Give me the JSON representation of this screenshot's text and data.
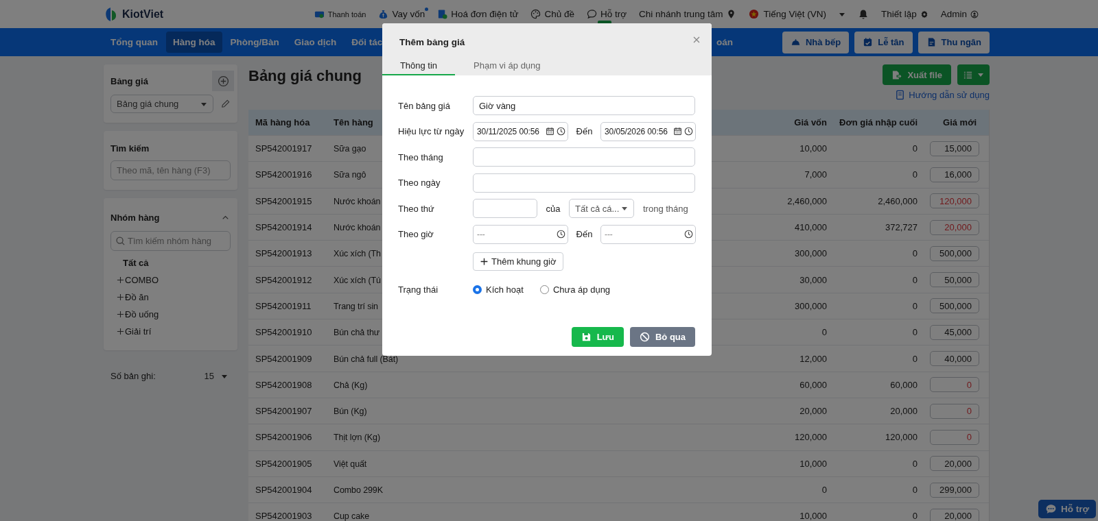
{
  "topbar": {
    "brand": "KiotViet",
    "items": [
      {
        "label": "Thanh toán",
        "dot": false,
        "marked": false
      },
      {
        "label": "Vay vốn",
        "dot": true,
        "marked": false
      },
      {
        "label": "Hoá đơn điện tử",
        "dot": false,
        "marked": false
      },
      {
        "label": "Chủ đề",
        "dot": false,
        "marked": false
      },
      {
        "label": "Hỗ trợ",
        "dot": false,
        "marked": true
      }
    ],
    "branch": "Chi nhánh trung tâm",
    "language": "Tiếng Việt (VN)",
    "settings": "Thiết lập",
    "user": "Admin"
  },
  "nav": {
    "items": [
      {
        "label": "Tổng quan",
        "selected": false
      },
      {
        "label": "Hàng hóa",
        "selected": true
      },
      {
        "label": "Phòng/Bàn",
        "selected": false
      },
      {
        "label": "Giao dịch",
        "selected": false
      },
      {
        "label": "Đối tác",
        "selected": false
      },
      {
        "label": "oán",
        "selected": false
      }
    ],
    "buttons": [
      "Nhà bếp",
      "Lễ tân",
      "Thu ngân"
    ]
  },
  "sidebar": {
    "price_list": {
      "title": "Bảng giá",
      "value": "Bảng giá chung"
    },
    "search": {
      "title": "Tìm kiếm",
      "placeholder": "Theo mã, tên hàng (F3)"
    },
    "groups": {
      "title": "Nhóm hàng",
      "expanded": true,
      "placeholder": "Tìm kiếm nhóm hàng",
      "all": {
        "label": "Tất cả",
        "selected": true
      },
      "items": [
        {
          "label": "COMBO",
          "expanded": false,
          "selected": false
        },
        {
          "label": "Đồ ăn",
          "expanded": false,
          "selected": false
        },
        {
          "label": "Đồ uống",
          "expanded": false,
          "selected": false
        },
        {
          "label": "Giải trí",
          "expanded": false,
          "selected": false
        }
      ]
    },
    "records": {
      "label": "Số bản ghi:",
      "value": "15"
    }
  },
  "main": {
    "title": "Bảng giá chung",
    "export": "Xuất file",
    "guide": "Hướng dẫn sử dụng",
    "table": {
      "columns": [
        "Mã hàng hóa",
        "Tên hàng",
        "Giá vốn",
        "Đơn giá nhập cuối",
        "Giá mới"
      ],
      "rows": [
        {
          "code": "SP542001917",
          "name": "Sữa gạo",
          "cost": "10,000",
          "last_price": "0",
          "new_price": "15,000",
          "warning": false
        },
        {
          "code": "SP542001916",
          "name": "Sữa ngô",
          "cost": "7,000",
          "last_price": "0",
          "new_price": "16,000",
          "warning": false
        },
        {
          "code": "SP542001915",
          "name": "Nước khoán",
          "cost": "2,460,000",
          "last_price": "2,460,000",
          "new_price": "120,000",
          "warning": true
        },
        {
          "code": "SP542001914",
          "name": "Nước khoán",
          "cost": "410,000",
          "last_price": "372,727",
          "new_price": "20,000",
          "warning": true
        },
        {
          "code": "SP542001913",
          "name": "Xúc xích (Th",
          "cost": "300,000",
          "last_price": "0",
          "new_price": "500,000",
          "warning": false
        },
        {
          "code": "SP542001912",
          "name": "Xúc xích (Tú",
          "cost": "30,000",
          "last_price": "0",
          "new_price": "50,000",
          "warning": false
        },
        {
          "code": "SP542001911",
          "name": "Trang trí sin",
          "cost": "300,000",
          "last_price": "0",
          "new_price": "500,000",
          "warning": false
        },
        {
          "code": "SP542001910",
          "name": "Bún chả thư",
          "cost": "0",
          "last_price": "0",
          "new_price": "45,000",
          "warning": false
        },
        {
          "code": "SP542001909",
          "name": "Bún chả full (Bát)",
          "cost": "12,000",
          "last_price": "0",
          "new_price": "40,000",
          "warning": false
        },
        {
          "code": "SP542001908",
          "name": "Chả (Kg)",
          "cost": "60,000",
          "last_price": "60,000",
          "new_price": "0",
          "warning": true
        },
        {
          "code": "SP542001907",
          "name": "Bún (Kg)",
          "cost": "20,000",
          "last_price": "20,000",
          "new_price": "0",
          "warning": true
        },
        {
          "code": "SP542001906",
          "name": "Thịt lợn (Kg)",
          "cost": "120,000",
          "last_price": "120,000",
          "new_price": "0",
          "warning": true
        },
        {
          "code": "SP542001905",
          "name": "Việt quất",
          "cost": "10,000",
          "last_price": "0",
          "new_price": "20,000",
          "warning": false
        },
        {
          "code": "SP542001904",
          "name": "Combo 299K",
          "cost": "0",
          "last_price": "0",
          "new_price": "299,000",
          "warning": false
        },
        {
          "code": "SP542001903",
          "name": "Cup cake",
          "cost": "10,000",
          "last_price": "0",
          "new_price": "20,000",
          "warning": false
        }
      ]
    }
  },
  "support_button": "Hỗ trợ",
  "dialog": {
    "title": "Thêm bảng giá",
    "tabs": [
      {
        "label": "Thông tin",
        "selected": true
      },
      {
        "label": "Phạm vi áp dụng",
        "selected": false
      }
    ],
    "name": {
      "label": "Tên bảng giá",
      "value": "Giờ vàng"
    },
    "validity": {
      "label": "Hiệu lực từ ngày",
      "from": "30/11/2025 00:56",
      "to_label": "Đến",
      "to": "30/05/2026 00:56"
    },
    "by_month": {
      "label": "Theo tháng"
    },
    "by_day": {
      "label": "Theo ngày"
    },
    "by_weekday": {
      "label": "Theo thứ",
      "of_label": "của",
      "select": "Tất cả cá...",
      "suffix": "trong tháng"
    },
    "by_hour": {
      "label": "Theo giờ",
      "from_placeholder": "---",
      "to_label": "Đến",
      "to_placeholder": "---"
    },
    "add_slot": "Thêm khung giờ",
    "status": {
      "label": "Trạng thái",
      "options": [
        {
          "label": "Kích hoạt",
          "selected": true
        },
        {
          "label": "Chưa áp dụng",
          "selected": false
        }
      ]
    },
    "buttons": [
      {
        "label": "Lưu",
        "kind": "primary"
      },
      {
        "label": "Bỏ qua",
        "kind": "secondary"
      }
    ]
  }
}
